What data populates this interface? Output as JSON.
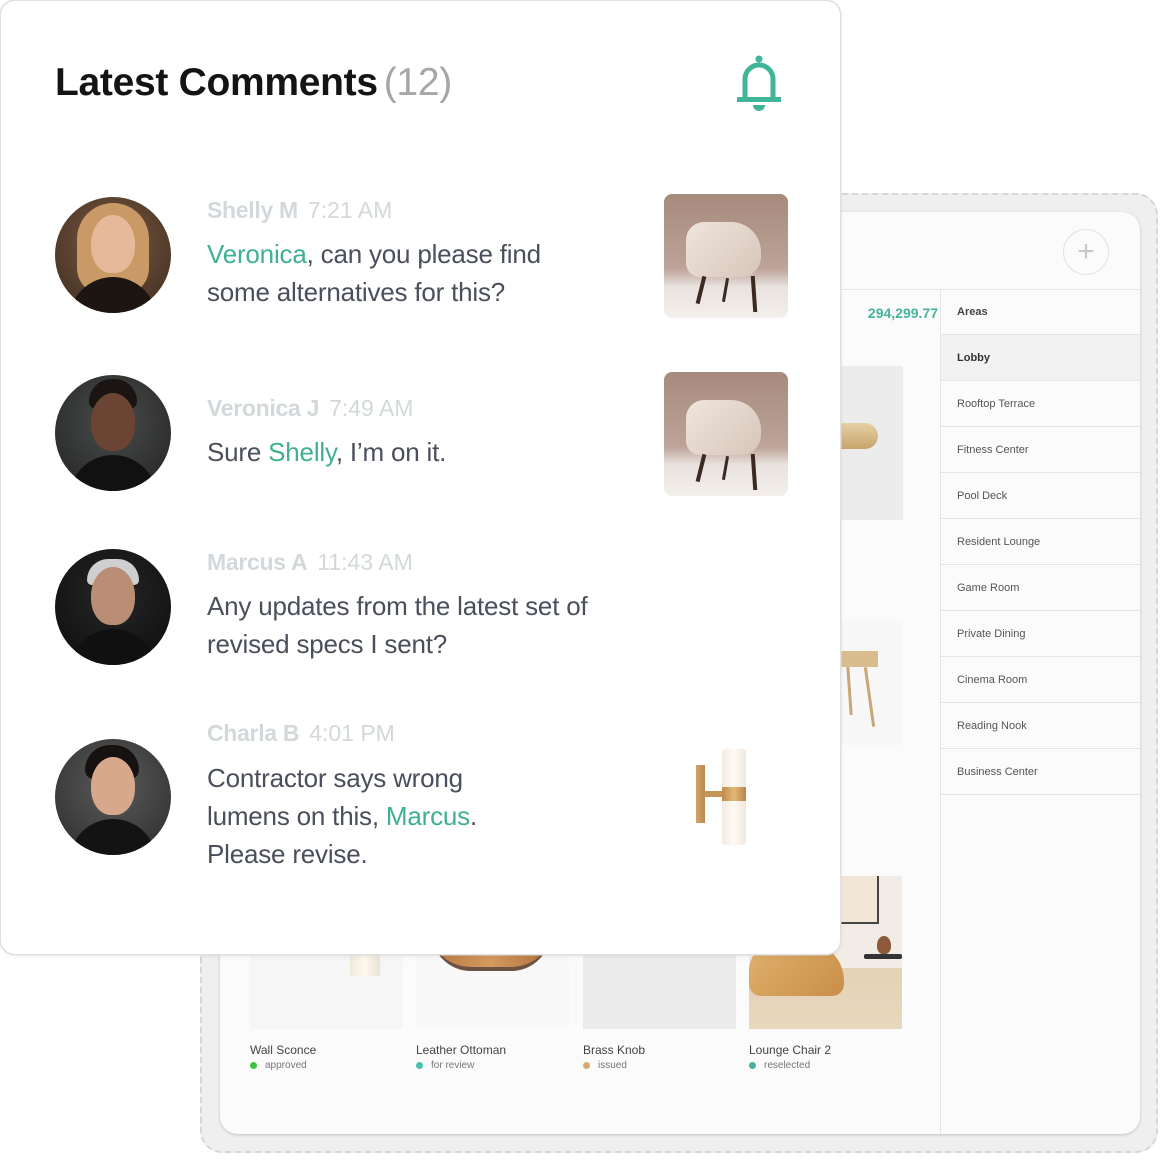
{
  "comments_panel": {
    "title": "Latest Comments",
    "count": "(12)",
    "bell_icon": "bell-icon",
    "accent_color": "#3fb191",
    "comments": [
      {
        "author": "Shelly M",
        "time": "7:21 AM",
        "avatar": "avatar-photo-shelly",
        "message_parts": [
          {
            "text": "Veronica",
            "mention": true
          },
          {
            "text": ", can you please find some alternatives for this?",
            "mention": false
          }
        ],
        "attachment": "lounge-chair-thumbnail"
      },
      {
        "author": "Veronica J",
        "time": "7:49 AM",
        "avatar": "avatar-photo-veronica",
        "message_parts": [
          {
            "text": "Sure ",
            "mention": false
          },
          {
            "text": "Shelly",
            "mention": true
          },
          {
            "text": ", I’m on it.",
            "mention": false
          }
        ],
        "attachment": "lounge-chair-thumbnail"
      },
      {
        "author": "Marcus A",
        "time": "11:43 AM",
        "avatar": "avatar-photo-marcus",
        "message_parts": [
          {
            "text": "Any updates from the latest set of revised specs I sent?",
            "mention": false
          }
        ],
        "attachment": null
      },
      {
        "author": "Charla B",
        "time": "4:01 PM",
        "avatar": "avatar-photo-charla",
        "message_parts": [
          {
            "text": "Contractor says wrong lumens on this, ",
            "mention": false
          },
          {
            "text": "Marcus",
            "mention": true
          },
          {
            "text": ". Please revise.",
            "mention": false
          }
        ],
        "attachment": "wall-sconce-thumbnail"
      }
    ]
  },
  "background_app": {
    "add_button_icon": "plus-icon",
    "total_amount": "294,299.77",
    "areas": {
      "header": "Areas",
      "items": [
        {
          "label": "Lobby",
          "active": true
        },
        {
          "label": "Rooftop Terrace",
          "active": false
        },
        {
          "label": "Fitness Center",
          "active": false
        },
        {
          "label": "Pool Deck",
          "active": false
        },
        {
          "label": "Resident Lounge",
          "active": false
        },
        {
          "label": "Game Room",
          "active": false
        },
        {
          "label": "Private Dining",
          "active": false
        },
        {
          "label": "Cinema Room",
          "active": false
        },
        {
          "label": "Reading Nook",
          "active": false
        },
        {
          "label": "Business Center",
          "active": false
        }
      ]
    },
    "products": [
      {
        "name": "Wall Sconce",
        "status": "approved",
        "status_color": "#3cc43c"
      },
      {
        "name": "Leather Ottoman",
        "status": "for review",
        "status_color": "#4bbfae"
      },
      {
        "name": "Brass Knob",
        "status": "issued",
        "status_color": "#d8ab6a"
      },
      {
        "name": "Lounge Chair 2",
        "status": "reselected",
        "status_color": "#4aaea0"
      }
    ]
  }
}
